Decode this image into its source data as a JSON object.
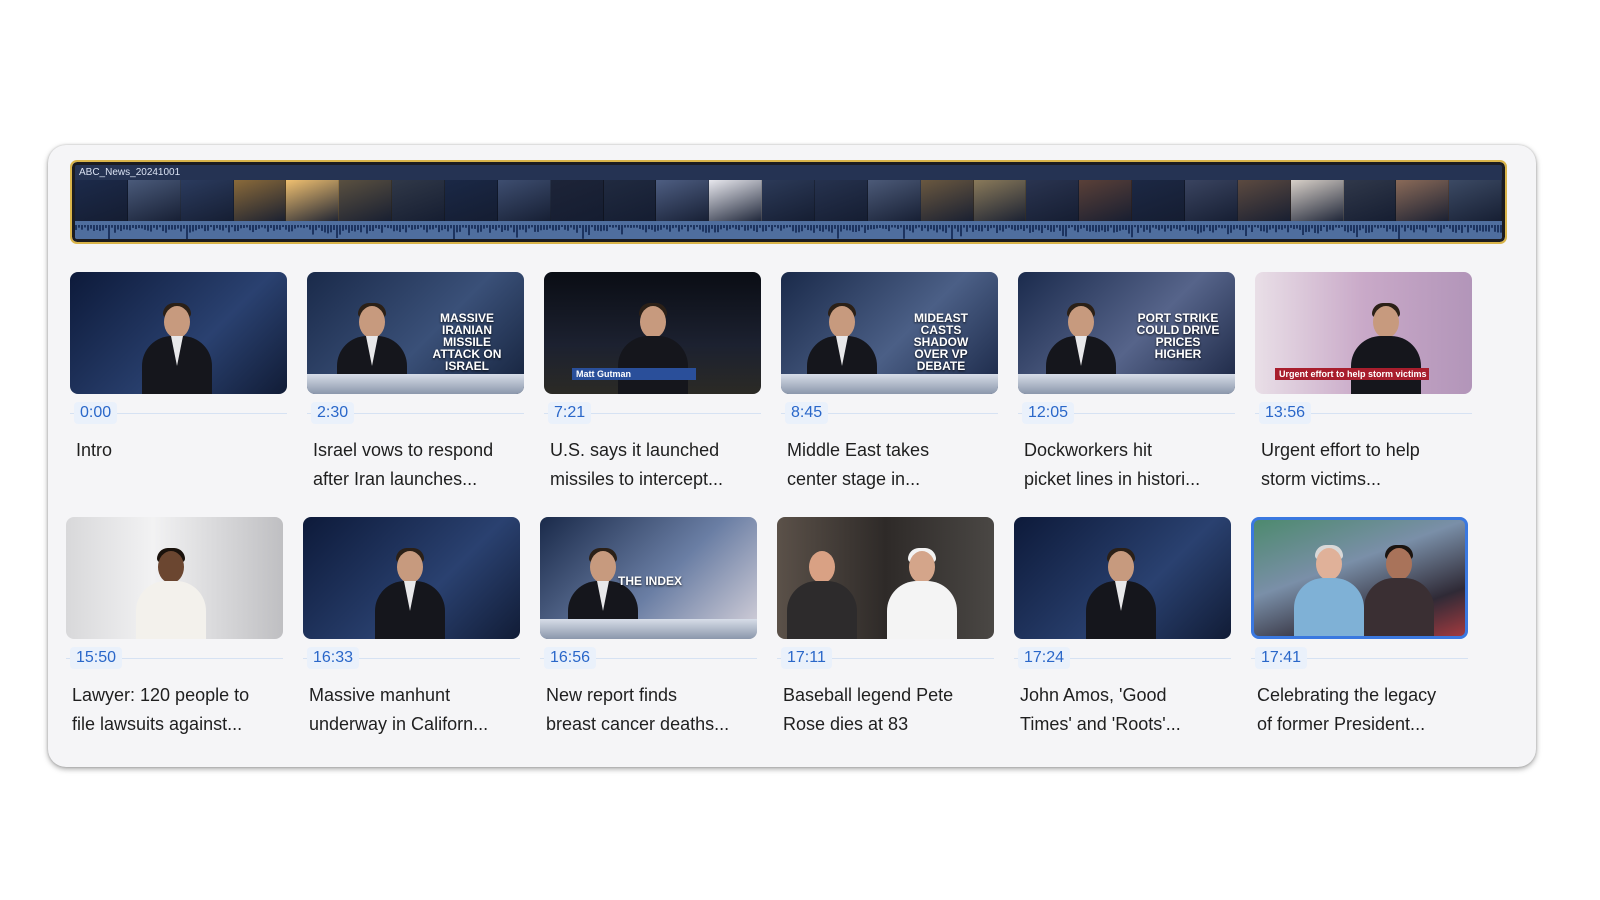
{
  "timeline": {
    "file_name": "ABC_News_20241001"
  },
  "chapters": [
    {
      "time": "0:00",
      "title": "Intro",
      "overlay": ""
    },
    {
      "time": "2:30",
      "title": "Israel vows to respond\nafter Iran launches...",
      "overlay": "Massive Iranian missile attack on Israel"
    },
    {
      "time": "7:21",
      "title": "U.S. says it launched\nmissiles to intercept...",
      "overlay": "Matt Gutman"
    },
    {
      "time": "8:45",
      "title": "Middle East takes\ncenter stage in...",
      "overlay": "Mideast casts shadow over VP debate"
    },
    {
      "time": "12:05",
      "title": "Dockworkers hit\npicket lines in histori...",
      "overlay": "Port strike could drive prices higher"
    },
    {
      "time": "13:56",
      "title": "Urgent effort to help\nstorm victims...",
      "overlay": "Urgent effort to help storm victims"
    },
    {
      "time": "15:50",
      "title": "Lawyer: 120 people to\nfile lawsuits against...",
      "overlay": ""
    },
    {
      "time": "16:33",
      "title": "Massive manhunt\nunderway in Californ...",
      "overlay": ""
    },
    {
      "time": "16:56",
      "title": "New report finds\nbreast cancer deaths...",
      "overlay": "The Index"
    },
    {
      "time": "17:11",
      "title": "Baseball legend Pete\nRose dies at 83",
      "overlay": ""
    },
    {
      "time": "17:24",
      "title": "John Amos, 'Good\nTimes' and 'Roots'...",
      "overlay": ""
    },
    {
      "time": "17:41",
      "title": "Celebrating the legacy\nof former President...",
      "overlay": ""
    }
  ],
  "colors": {
    "accent": "#2a67c9",
    "selected_border": "#3a78e0",
    "timeline_border": "#d9b44a"
  },
  "selected_chapter": 11
}
